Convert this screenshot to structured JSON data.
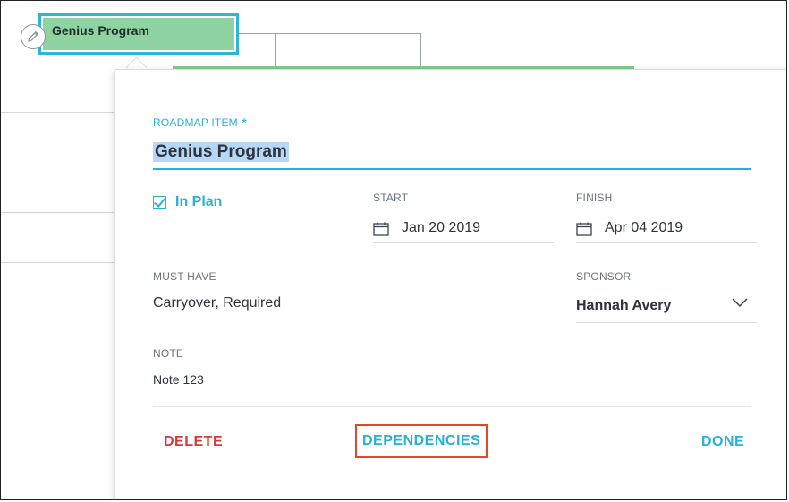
{
  "roadmap_chip": {
    "title": "Genius Program",
    "color": "#8fd3a2",
    "selected_border_color": "#29b6d8",
    "icon": "pencil-icon"
  },
  "popup": {
    "roadmap_item_label": "ROADMAP ITEM",
    "required_marker": "*",
    "roadmap_item_value": "Genius Program",
    "in_plan": {
      "label": "In Plan",
      "checked": true
    },
    "start": {
      "label": "START",
      "value": "Jan 20 2019",
      "icon": "calendar-icon"
    },
    "finish": {
      "label": "FINISH",
      "value": "Apr 04 2019",
      "icon": "calendar-icon"
    },
    "must_have": {
      "label": "MUST HAVE",
      "value": "Carryover, Required"
    },
    "sponsor": {
      "label": "SPONSOR",
      "value": "Hannah Avery",
      "icon": "chevron-down-icon"
    },
    "note": {
      "label": "NOTE",
      "value": "Note 123"
    },
    "buttons": {
      "delete": "DELETE",
      "dependencies": "DEPENDENCIES",
      "done": "DONE"
    }
  },
  "colors": {
    "accent": "#2ab0d5",
    "danger": "#d9363e",
    "highlight_border": "#e3472a",
    "timeline_bar": "#7fcb8d"
  }
}
